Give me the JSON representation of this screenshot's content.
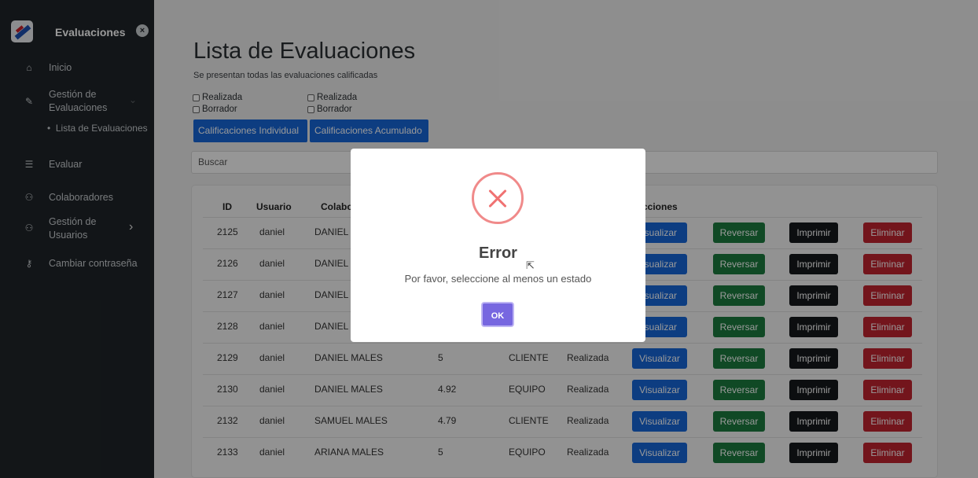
{
  "sidebar": {
    "title": "Evaluaciones",
    "close_glyph": "×",
    "items": {
      "inicio": "Inicio",
      "gestion_eval_l1": "Gestión de",
      "gestion_eval_l2": "Evaluaciones",
      "lista_eval": "Lista de Evaluaciones",
      "evaluar": "Evaluar",
      "colaboradores": "Colaboradores",
      "gestion_usr_l1": "Gestión de",
      "gestion_usr_l2": "Usuarios",
      "cambiar": "Cambiar contraseña"
    }
  },
  "page": {
    "title": "Lista de Evaluaciones",
    "subtitle": "Se presentan todas las evaluaciones calificadas",
    "filters_a": [
      "Realizada",
      "Borrador"
    ],
    "filters_b": [
      "Realizada",
      "Borrador"
    ],
    "tabs": [
      "Calificaciones Individual",
      "Calificaciones Acumulado"
    ],
    "search_placeholder": "Buscar"
  },
  "table": {
    "headers": {
      "id": "ID",
      "usuario": "Usuario",
      "colaborador": "Colabo",
      "acciones": "cciones"
    },
    "rows": [
      {
        "id": "2125",
        "usuario": "daniel",
        "colaborador": "DANIEL I",
        "puntaje": "",
        "tipo": "",
        "estado": ""
      },
      {
        "id": "2126",
        "usuario": "daniel",
        "colaborador": "DANIEL I",
        "puntaje": "",
        "tipo": "",
        "estado": ""
      },
      {
        "id": "2127",
        "usuario": "daniel",
        "colaborador": "DANIEL I",
        "puntaje": "",
        "tipo": "",
        "estado": ""
      },
      {
        "id": "2128",
        "usuario": "daniel",
        "colaborador": "DANIEL I",
        "puntaje": "",
        "tipo": "",
        "estado": ""
      },
      {
        "id": "2129",
        "usuario": "daniel",
        "colaborador": "DANIEL MALES",
        "puntaje": "5",
        "tipo": "CLIENTE",
        "estado": "Realizada"
      },
      {
        "id": "2130",
        "usuario": "daniel",
        "colaborador": "DANIEL MALES",
        "puntaje": "4.92",
        "tipo": "EQUIPO",
        "estado": "Realizada"
      },
      {
        "id": "2132",
        "usuario": "daniel",
        "colaborador": "SAMUEL MALES",
        "puntaje": "4.79",
        "tipo": "CLIENTE",
        "estado": "Realizada"
      },
      {
        "id": "2133",
        "usuario": "daniel",
        "colaborador": "ARIANA MALES",
        "puntaje": "5",
        "tipo": "EQUIPO",
        "estado": "Realizada"
      }
    ],
    "actions": {
      "visualizar_full": "Visualizar",
      "visualizar_clipped": "isualizar",
      "reversar": "Reversar",
      "imprimir": "Imprimir",
      "eliminar": "Eliminar"
    }
  },
  "modal": {
    "title": "Error",
    "message": "Por favor, seleccione al menos un estado",
    "ok": "OK"
  },
  "icons": {
    "home": "⌂",
    "wrench": "✎",
    "list": "☰",
    "users": "⚇",
    "key": "⚷",
    "chevron_down": "⌄",
    "chevron_right": "›",
    "cursor": "⇱"
  },
  "colors": {
    "primary": "#1666d8",
    "success": "#1b7a3e",
    "dark": "#15181b",
    "danger": "#c0232f",
    "ok": "#7767e0",
    "error": "#f07272"
  }
}
